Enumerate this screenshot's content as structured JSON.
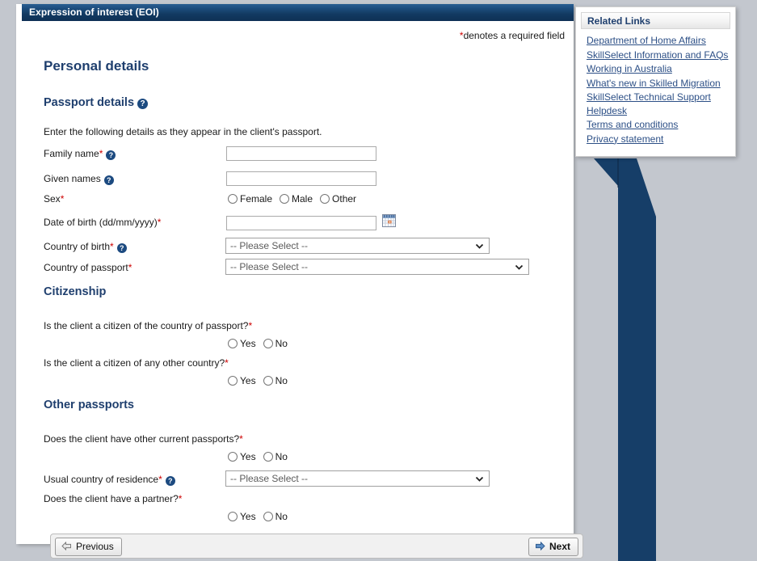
{
  "window": {
    "title": "Expression of interest (EOI)",
    "required_note_star": "*",
    "required_note_text": "denotes a required field"
  },
  "colors": {
    "page_background": "#c3c7ce",
    "titlebar_blue": "#123a61",
    "heading_blue": "#1f3f6e",
    "ribbon_blue": "#163e68",
    "required_red": "#cc0000",
    "link_blue": "#2c4f86",
    "help_icon_blue": "#1c4a80"
  },
  "form": {
    "page_heading": "Personal details",
    "sections": {
      "passport": {
        "heading": "Passport details",
        "help_icon": "help-circle-icon",
        "intro": "Enter the following details as they appear in the client's passport.",
        "fields": {
          "family_name": {
            "label": "Family name",
            "required": "*",
            "help_icon": "help-circle-icon",
            "value": "",
            "type": "text"
          },
          "given_names": {
            "label": "Given names",
            "required": "",
            "help_icon": "help-circle-icon",
            "value": "",
            "type": "text"
          },
          "sex": {
            "label": "Sex",
            "required": "*",
            "type": "radio",
            "options": [
              "Female",
              "Male",
              "Other"
            ],
            "selected": ""
          },
          "date_of_birth": {
            "label": "Date of birth (dd/mm/yyyy)",
            "required": "*",
            "value": "",
            "type": "text",
            "icon": "calendar-icon"
          },
          "country_of_birth": {
            "label": "Country of birth",
            "required": "*",
            "help_icon": "help-circle-icon",
            "value": "-- Please Select --",
            "type": "select"
          },
          "country_of_passport": {
            "label": "Country of passport",
            "required": "*",
            "value": "-- Please Select --",
            "type": "select"
          }
        }
      },
      "citizenship": {
        "heading": "Citizenship",
        "questions": [
          {
            "label": "Is the client a citizen of the country of passport?",
            "required": "*",
            "options": [
              "Yes",
              "No"
            ],
            "selected": ""
          },
          {
            "label": "Is the client a citizen of any other country?",
            "required": "*",
            "options": [
              "Yes",
              "No"
            ],
            "selected": ""
          }
        ]
      },
      "other_passports": {
        "heading": "Other passports",
        "q_other_passports": {
          "label": "Does the client have other current passports?",
          "required": "*",
          "options": [
            "Yes",
            "No"
          ],
          "selected": ""
        },
        "usual_country": {
          "label": "Usual country of residence",
          "required": "*",
          "help_icon": "help-circle-icon",
          "value": "-- Please Select --",
          "type": "select"
        },
        "q_partner": {
          "label": "Does the client have a partner?",
          "required": "*",
          "options": [
            "Yes",
            "No"
          ],
          "selected": ""
        }
      }
    },
    "nav": {
      "previous_label": "Previous",
      "next_label": "Next",
      "previous_icon": "arrow-left-icon",
      "next_icon": "arrow-right-icon"
    }
  },
  "related_links": {
    "heading": "Related Links",
    "items": [
      "Department of Home Affairs",
      "SkillSelect Information and FAQs",
      "Working in Australia",
      "What's new in Skilled Migration",
      "SkillSelect Technical Support Helpdesk",
      "Terms and conditions",
      "Privacy statement"
    ]
  }
}
